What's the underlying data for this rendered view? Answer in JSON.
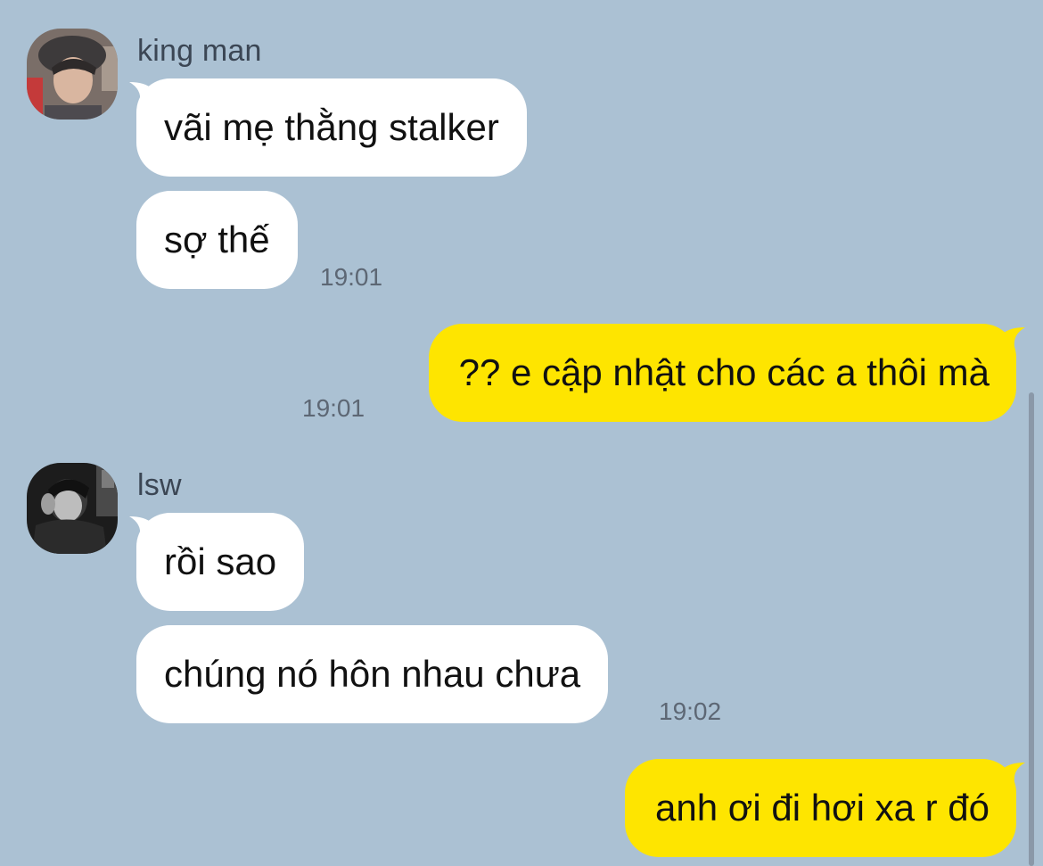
{
  "chat": {
    "messages": [
      {
        "sender": "king man",
        "direction": "incoming",
        "avatar": "avatar-king-man",
        "bubbles": [
          "vãi mẹ thằng stalker",
          "sợ thế"
        ],
        "time": "19:01"
      },
      {
        "direction": "outgoing",
        "bubbles": [
          "?? e cập nhật cho các a thôi mà"
        ],
        "time": "19:01"
      },
      {
        "sender": "lsw",
        "direction": "incoming",
        "avatar": "avatar-lsw",
        "bubbles": [
          "rồi sao",
          "chúng nó hôn nhau chưa"
        ],
        "time": "19:02"
      },
      {
        "direction": "outgoing",
        "bubbles": [
          "anh ơi đi hơi xa r đó"
        ]
      }
    ]
  },
  "colors": {
    "background": "#abc1d3",
    "incoming_bubble": "#ffffff",
    "outgoing_bubble": "#fee500",
    "text": "#111111",
    "sender_name": "#3b4654",
    "timestamp": "#5d6774"
  }
}
